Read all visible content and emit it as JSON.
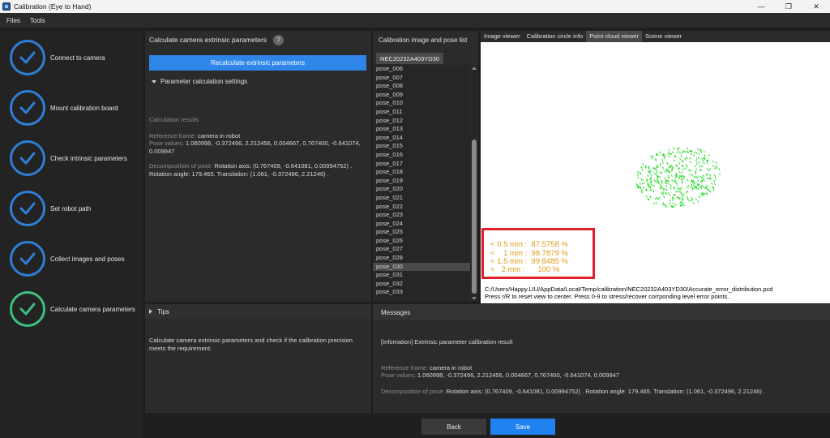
{
  "window": {
    "title": "Calibration (Eye to Hand)",
    "minimize_glyph": "—",
    "maximize_glyph": "❐",
    "close_glyph": "✕"
  },
  "menu": {
    "files": "Files",
    "tools": "Tools"
  },
  "steps": [
    {
      "label": "Connect to camera",
      "icon": "check-icon",
      "color": "#2f7fd6"
    },
    {
      "label": "Mount calibration board",
      "icon": "check-icon",
      "color": "#2f7fd6"
    },
    {
      "label": "Check intrinsic parameters",
      "icon": "check-icon",
      "color": "#2f7fd6"
    },
    {
      "label": "Set robot path",
      "icon": "check-icon",
      "color": "#2f7fd6"
    },
    {
      "label": "Collect images and poses",
      "icon": "check-icon",
      "color": "#2f7fd6"
    },
    {
      "label": "Calculate camera parameters",
      "icon": "check-icon",
      "color": "#3fbf7f"
    }
  ],
  "calc_panel": {
    "title": "Calculate camera extrinsic parameters",
    "help": "?",
    "recalc_label": "Recalculate extrinsic parameters",
    "param_settings": "Parameter calculation settings",
    "results_heading": "Calculation results",
    "ref_frame_label": "Reference frame:",
    "ref_frame_value": "camera in robot",
    "pose_values_label": "Pose values:",
    "pose_values": "1.060998, -0.372496, 2.212456, 0.004667, 0.767400, -0.641074, 0.009947",
    "decomp_label": "Decomposition of pose:",
    "decomp_line1": "Rotation axis: (0.767409, -0.641081, 0.00994752) .",
    "decomp_line2": "Rotation angle: 179.465. Translation: (1.061, -0.372496, 2.21246) ."
  },
  "pose_list": {
    "title": "Calibration image and pose list",
    "serial": "NEC20232A403YD30",
    "items": [
      "pose_006",
      "pose_007",
      "pose_008",
      "pose_009",
      "pose_010",
      "pose_011",
      "pose_012",
      "pose_013",
      "pose_014",
      "pose_015",
      "pose_016",
      "pose_017",
      "pose_018",
      "pose_019",
      "pose_020",
      "pose_021",
      "pose_022",
      "pose_023",
      "pose_024",
      "pose_025",
      "pose_026",
      "pose_027",
      "pose_028",
      "pose_030",
      "pose_031",
      "pose_032",
      "pose_033"
    ],
    "selected": "pose_030"
  },
  "viewer": {
    "tabs": [
      "Image viewer",
      "Calibration circle info",
      "Point cloud viewer",
      "Scene viewer"
    ],
    "active_tab": "Point cloud viewer",
    "error_lines": [
      "< 0.5 mm :  87.5758 %",
      "<    1 mm :  98.7879 %",
      "< 1.5 mm :  99.8485 %",
      "<   2 mm :      100 %"
    ],
    "file_path": "C:/Users/Happy.LIU/AppData/Local/Temp/calibration/NEC20232A403YD30/Accurate_error_distribution.pcd",
    "hint": "Press r/R to reset view to center. Press 0-9 to stress/recover corrponding level error points.",
    "point_color": "#22dd22"
  },
  "tips": {
    "title": "Tips",
    "body": "Calculate camera extrinsic parameters and check if the calibration precision meets the requirement."
  },
  "messages": {
    "title": "Messages",
    "info": "[Infomation] Extrinsic parameter calibration result",
    "ref_frame_label": "Reference frame:",
    "ref_frame_value": "camera in robot",
    "pose_values_label": "Pose values:",
    "pose_values": "1.060998, -0.372496, 2.212456, 0.004667, 0.767400, -0.641074, 0.009947",
    "decomp_label": "Decomposition of pose:",
    "decomp_value": "Rotation axis: (0.767409, -0.641081, 0.00994752) . Rotation angle: 179.465. Translation: (1.061, -0.372496, 2.21246) ."
  },
  "footer": {
    "back": "Back",
    "save": "Save"
  }
}
